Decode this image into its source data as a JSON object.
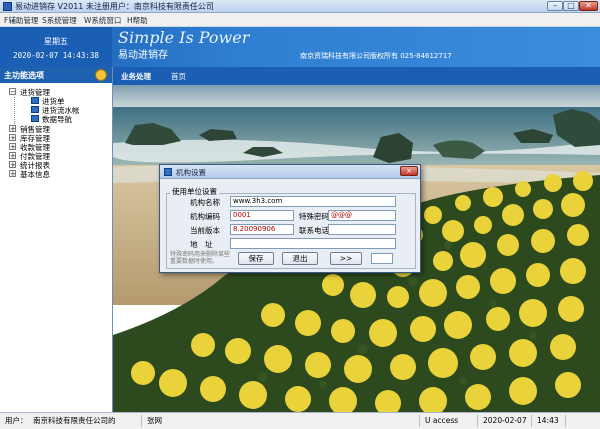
{
  "window": {
    "title": "易动进销存 V2011 未注册用户：南京科技有限责任公司"
  },
  "menu": {
    "items": [
      {
        "label": "F辅助管理"
      },
      {
        "label": "S系统管理"
      },
      {
        "label": "W系统窗口"
      },
      {
        "label": "H帮助"
      }
    ]
  },
  "header": {
    "weekday": "星期五",
    "datetime": "2020-02-07 14:43:38",
    "slogan": "Simple Is Power",
    "app_title": "易动进销存",
    "copyright": "南京资瑞科技有限公司版权所有 025-84612717"
  },
  "sidebar": {
    "title": "主功能选项",
    "tree": [
      {
        "label": "进货管理",
        "expanded": true,
        "children": [
          {
            "label": "进货单"
          },
          {
            "label": "进货流水帐"
          },
          {
            "label": "数据导航"
          }
        ]
      },
      {
        "label": "销售管理"
      },
      {
        "label": "库存管理"
      },
      {
        "label": "收款管理"
      },
      {
        "label": "付款管理"
      },
      {
        "label": "统计报表"
      },
      {
        "label": "基本信息"
      }
    ]
  },
  "tabs": [
    {
      "label": "业务处理",
      "active": true
    },
    {
      "label": "首页",
      "active": false
    }
  ],
  "dialog": {
    "title": "机构设置",
    "close_label": "×",
    "group_label": "使用单位设置",
    "org_name_label": "机构名称",
    "org_name_value": "www.3h3.com",
    "org_code_label": "机构编码",
    "org_code_value": "0001",
    "special_pw_label": "特殊密码",
    "special_pw_value": "@@@",
    "version_label": "当前版本",
    "version_value": "8.20090906",
    "phone_label": "联系电话",
    "phone_value": "",
    "address_label": "地　址",
    "address_value": "",
    "hint": "特殊密码用来删除某些重要数据时使用。",
    "save_label": "保存",
    "exit_label": "退出",
    "more_label": ">>",
    "extra_value": ""
  },
  "status": {
    "user_label": "用户：",
    "company": "南京科技有限责任公司的",
    "user_name": "张网",
    "mode": "U access",
    "date": "2020-02-07",
    "time": "14:43"
  },
  "colors": {
    "header_blue": "#1a5fb4",
    "sidebar_header": "#1e61b0",
    "dialog_bg": "#e9eef5",
    "red_text": "#b00000"
  }
}
